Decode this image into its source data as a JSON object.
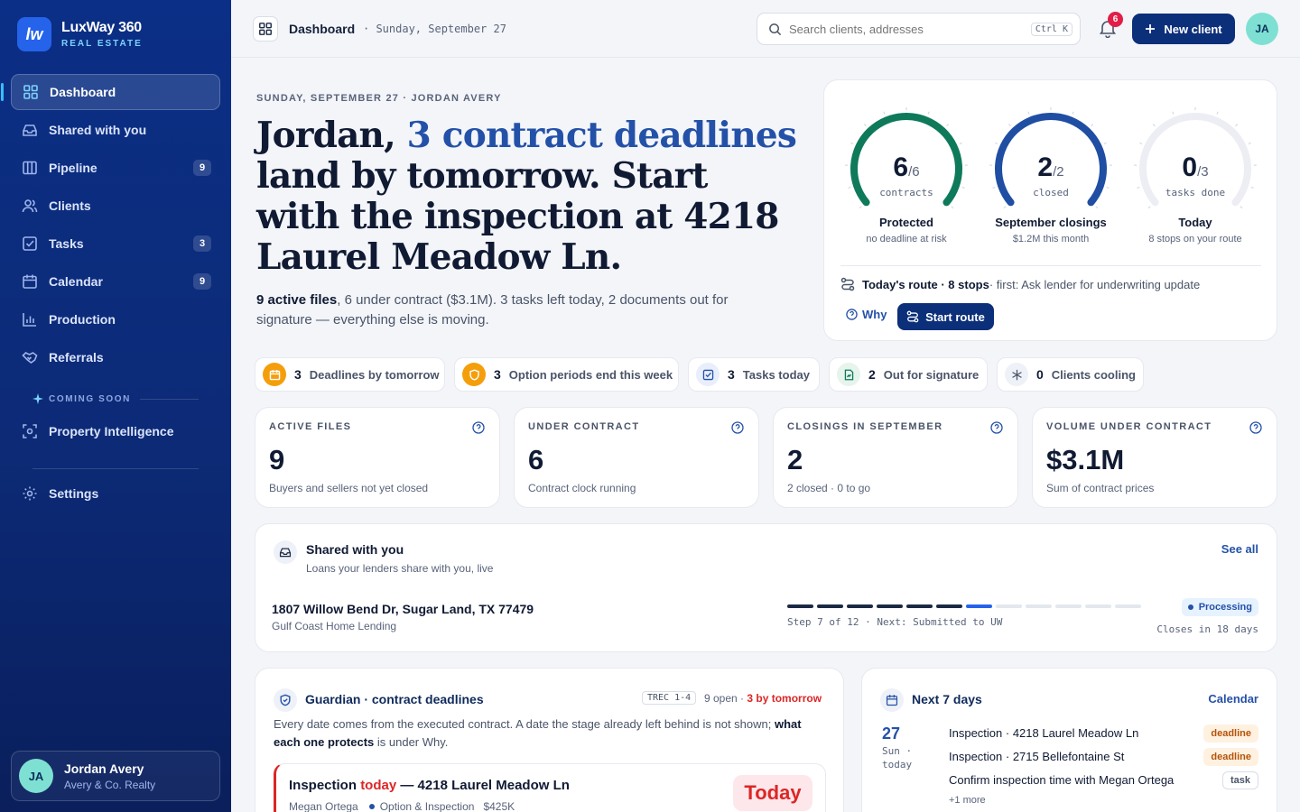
{
  "brand": {
    "logo": "lw",
    "name": "LuxWay 360",
    "subtitle": "REAL ESTATE"
  },
  "sidebar": {
    "items": [
      {
        "label": "Dashboard",
        "icon": "grid-icon",
        "active": true,
        "badge": ""
      },
      {
        "label": "Shared with you",
        "icon": "inbox-icon",
        "badge": ""
      },
      {
        "label": "Pipeline",
        "icon": "columns-icon",
        "badge": "9"
      },
      {
        "label": "Clients",
        "icon": "users-icon",
        "badge": ""
      },
      {
        "label": "Tasks",
        "icon": "checkbox-icon",
        "badge": "3"
      },
      {
        "label": "Calendar",
        "icon": "calendar-icon",
        "badge": "9"
      },
      {
        "label": "Production",
        "icon": "bar-chart-icon",
        "badge": ""
      },
      {
        "label": "Referrals",
        "icon": "handshake-icon",
        "badge": ""
      }
    ],
    "coming_soon_label": "COMING SOON",
    "property_intelligence": "Property Intelligence",
    "settings": "Settings",
    "user": {
      "initials": "JA",
      "name": "Jordan Avery",
      "org": "Avery & Co. Realty"
    }
  },
  "topbar": {
    "title": "Dashboard",
    "date": "· Sunday, September 27",
    "search_placeholder": "Search clients, addresses",
    "shortcut": "Ctrl K",
    "notifications": "6",
    "new_client": "New client",
    "avatar": "JA"
  },
  "hero": {
    "eyebrow": "SUNDAY, SEPTEMBER 27 · JORDAN AVERY",
    "title_pre": "Jordan, ",
    "title_hl": "3 contract deadlines",
    "title_post": " land by tomorrow. Start with the inspection at 4218 Laurel Meadow Ln.",
    "sub_bold": "9 active files",
    "sub_rest": ", 6 under contract ($3.1M). 3 tasks left today, 2 documents out for signature — everything else is moving."
  },
  "gauges": [
    {
      "value": "6",
      "total": "/6",
      "unit": "contracts",
      "label": "Protected",
      "sub": "no deadline at risk",
      "fraction": 1.0,
      "color": "#0e7a5a"
    },
    {
      "value": "2",
      "total": "/2",
      "unit": "closed",
      "label": "September closings",
      "sub": "$1.2M this month",
      "fraction": 1.0,
      "color": "#1f4ea3"
    },
    {
      "value": "0",
      "total": "/3",
      "unit": "tasks done",
      "label": "Today",
      "sub": "8 stops on your route",
      "fraction": 0.0,
      "color": "#1f4ea3"
    }
  ],
  "route": {
    "label": "Today's route · 8 stops",
    "detail": " · first: Ask lender for underwriting update",
    "why": "Why",
    "start": "Start route"
  },
  "chips": [
    {
      "num": "3",
      "label": "Deadlines by tomorrow",
      "icon": "calendar-icon",
      "bg": "#f59e0b"
    },
    {
      "num": "3",
      "label": "Option periods end this week",
      "icon": "shield-icon",
      "bg": "#f59e0b"
    },
    {
      "num": "3",
      "label": "Tasks today",
      "icon": "checkbox-icon",
      "bg": "#e8eefb"
    },
    {
      "num": "2",
      "label": "Out for signature",
      "icon": "signature-icon",
      "bg": "#e6f4ec"
    },
    {
      "num": "0",
      "label": "Clients cooling",
      "icon": "snowflake-icon",
      "bg": "#eef1f7"
    }
  ],
  "kpis": [
    {
      "label": "ACTIVE FILES",
      "value": "9",
      "sub": "Buyers and sellers not yet closed"
    },
    {
      "label": "UNDER CONTRACT",
      "value": "6",
      "sub": "Contract clock running"
    },
    {
      "label": "CLOSINGS IN SEPTEMBER",
      "value": "2",
      "sub": "2 closed · 0 to go"
    },
    {
      "label": "VOLUME UNDER CONTRACT",
      "value": "$3.1M",
      "sub": "Sum of contract prices"
    }
  ],
  "shared": {
    "title": "Shared with you",
    "sub": "Loans your lenders share with you, live",
    "see_all": "See all",
    "address": "1807 Willow Bend Dr, Sugar Land, TX 77479",
    "lender": "Gulf Coast Home Lending",
    "step_current": 7,
    "step_total": 12,
    "step_text": "Step 7 of 12 · Next: Submitted to UW",
    "status": "Processing",
    "closes": "Closes in 18 days"
  },
  "guardian": {
    "title": "Guardian · contract deadlines",
    "trec": "TREC 1-4",
    "open": "9 open · ",
    "tomorrow": "3 by tomorrow",
    "desc_1": "Every date comes from the executed contract. A date the stage already left behind is not shown; ",
    "desc_b1": "what each one protects",
    "desc_2": " is under Why.",
    "item": {
      "pre": "Inspection ",
      "red": "today",
      "post": " — 4218 Laurel Meadow Ln",
      "person": "Megan Ortega",
      "period": "Option & Inspection",
      "price": "$425K",
      "badge": "Today"
    }
  },
  "next7": {
    "title": "Next 7 days",
    "calendar": "Calendar",
    "day": "27",
    "day_label": "Sun · today",
    "events": [
      {
        "text": "Inspection · 4218 Laurel Meadow Ln",
        "tag": "deadline"
      },
      {
        "text": "Inspection · 2715 Bellefontaine St",
        "tag": "deadline"
      },
      {
        "text": "Confirm inspection time with Megan Ortega",
        "tag": "task"
      }
    ],
    "more": "+1 more"
  }
}
